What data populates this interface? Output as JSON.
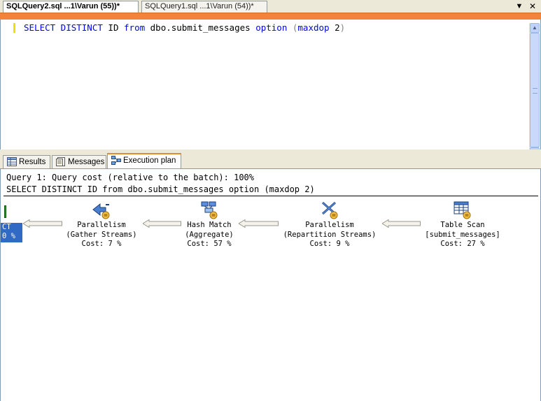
{
  "document_tabs": [
    {
      "label": "SQLQuery2.sql ...1\\Varun (55))*",
      "active": true
    },
    {
      "label": "SQLQuery1.sql ...1\\Varun (54))*",
      "active": false
    }
  ],
  "window_controls": {
    "dropdown": "▼",
    "close": "✕"
  },
  "editor": {
    "query": {
      "kw1": "SELECT DISTINCT",
      "col": "ID",
      "kw2": "from",
      "table": "dbo.submit_messages",
      "kw3": "option",
      "open": "(",
      "kw4": "maxdop",
      "arg": "2",
      "close": ")"
    }
  },
  "result_tabs": [
    {
      "label": "Results",
      "icon": "grid-icon"
    },
    {
      "label": "Messages",
      "icon": "messages-icon"
    },
    {
      "label": "Execution plan",
      "icon": "execution-plan-icon",
      "active": true
    }
  ],
  "plan": {
    "header_line1": "Query 1: Query cost (relative to the batch): 100%",
    "header_line2": "SELECT DISTINCT ID from dbo.submit_messages option (maxdop 2)",
    "select_node": {
      "line1": "CT",
      "line2": "0 %"
    },
    "operators": [
      {
        "name": "Parallelism",
        "detail": "(Gather Streams)",
        "cost": "Cost: 7 %",
        "icon": "parallelism-gather-icon"
      },
      {
        "name": "Hash Match",
        "detail": "(Aggregate)",
        "cost": "Cost: 57 %",
        "icon": "hash-match-icon"
      },
      {
        "name": "Parallelism",
        "detail": "(Repartition Streams)",
        "cost": "Cost: 9 %",
        "icon": "parallelism-repartition-icon"
      },
      {
        "name": "Table Scan",
        "detail": "[submit_messages]",
        "cost": "Cost: 27 %",
        "icon": "table-scan-icon"
      }
    ]
  },
  "colors": {
    "accent_bar": "#f0843c",
    "keyword": "#0000ff",
    "selection": "#316ac5"
  }
}
